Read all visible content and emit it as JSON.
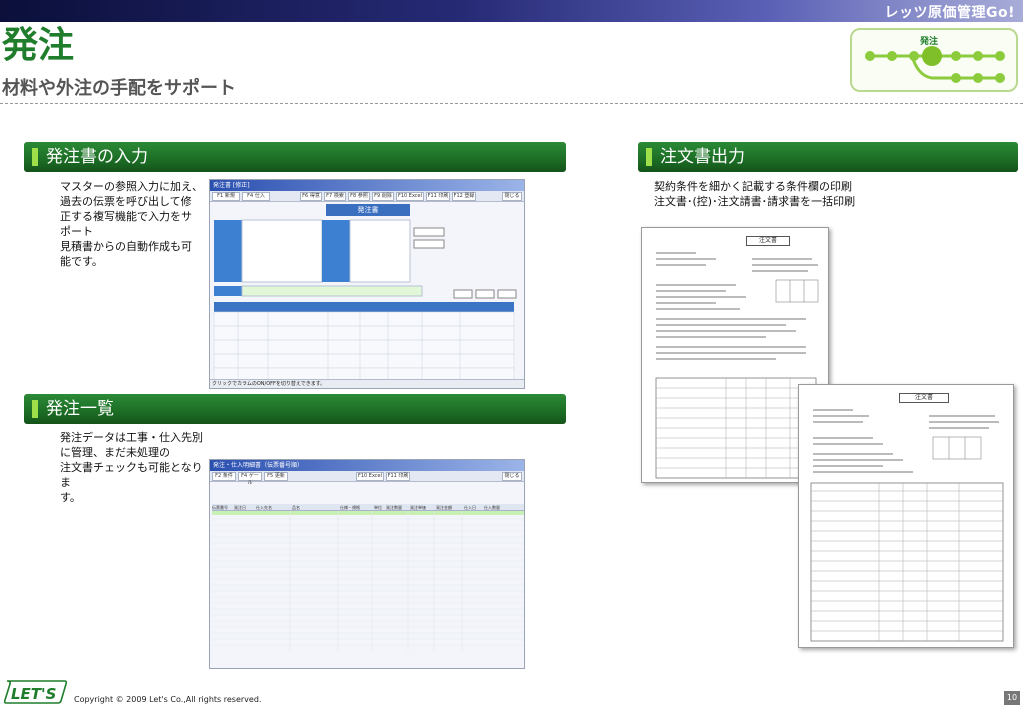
{
  "header": {
    "brand": "レッツ原価管理Go!",
    "title": "発注",
    "subtitle": "材料や外注の手配をサポート",
    "flow_label": "発注"
  },
  "sections": {
    "order_input": {
      "heading": "発注書の入力",
      "lines": [
        "マスターの参照入力に加え、",
        "過去の伝票を呼び出して修",
        "正する複写機能で入力をサ",
        "ポート",
        "見積書からの自動作成も可",
        "能です。"
      ]
    },
    "order_list": {
      "heading": "発注一覧",
      "lines": [
        "発注データは工事・仕入先別",
        "に管理、まだ未処理の",
        "注文書チェックも可能となりま",
        "す。"
      ]
    },
    "order_print": {
      "heading": "注文書出力",
      "lines": [
        "契約条件を細かく記載する条件欄の印刷",
        "注文書･(控)･注文請書･請求書を一括印刷"
      ]
    }
  },
  "screenshot_order_input": {
    "window_title": "発注書 [修正]",
    "toolbar": [
      "F1 新規",
      "F4 仕入",
      "F6 得意",
      "F7 検索",
      "F8 参照",
      "F9 削除",
      "F10 Excel",
      "F11 印刷",
      "F12 登録",
      "閉じる"
    ],
    "form_title": "発注書",
    "status": "クリックでカラムのON/OFFを切り替えできます。"
  },
  "screenshot_order_list": {
    "window_title": "発注・仕入明細書（伝票番号順）",
    "toolbar": [
      "F2 条件",
      "F4 ゲール",
      "F5 更新",
      "F10 Excel",
      "F11 印刷",
      "閉じる"
    ],
    "columns": [
      "伝票番号",
      "発注日",
      "仕入先名",
      "品名",
      "仕様・規格",
      "単位",
      "発注数量",
      "発注単価",
      "発注金額",
      "仕入日",
      "仕入数量"
    ]
  },
  "documents": {
    "primary_title": "注文書",
    "secondary_title": "注文書"
  },
  "footer": {
    "logo_text": "LET'S",
    "copyright": "Copyright © 2009 Let's Co.,All rights reserved.",
    "page_number": "10"
  },
  "colors": {
    "accent_green": "#1f7d2b",
    "banner_navy": "#0b0f3a",
    "highlight_green": "#9fe04a"
  }
}
